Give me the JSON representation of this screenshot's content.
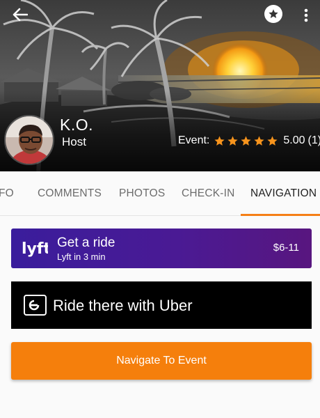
{
  "header": {
    "back_icon": "arrow-left-icon",
    "favorite_icon": "star-circle-icon",
    "more_icon": "more-vertical-icon",
    "host": {
      "name": "K.O.",
      "role": "Host"
    },
    "event_rating": {
      "label": "Event:",
      "stars": 5,
      "value": "5.00",
      "count": "(1)"
    }
  },
  "tabs": [
    {
      "label": "FO",
      "active": false
    },
    {
      "label": "COMMENTS",
      "active": false
    },
    {
      "label": "PHOTOS",
      "active": false
    },
    {
      "label": "CHECK-IN",
      "active": false
    },
    {
      "label": "NAVIGATION",
      "active": true
    }
  ],
  "lyft": {
    "logo_text": "lyft",
    "title": "Get a ride",
    "subtitle": "Lyft in 3 min",
    "price": "$6-11"
  },
  "uber": {
    "label": "Ride there with Uber"
  },
  "navigate_button": {
    "label": "Navigate To Event"
  },
  "colors": {
    "accent": "#f57f17",
    "lyft": "#3a1d9c",
    "uber": "#000000",
    "star": "#f7941d"
  }
}
